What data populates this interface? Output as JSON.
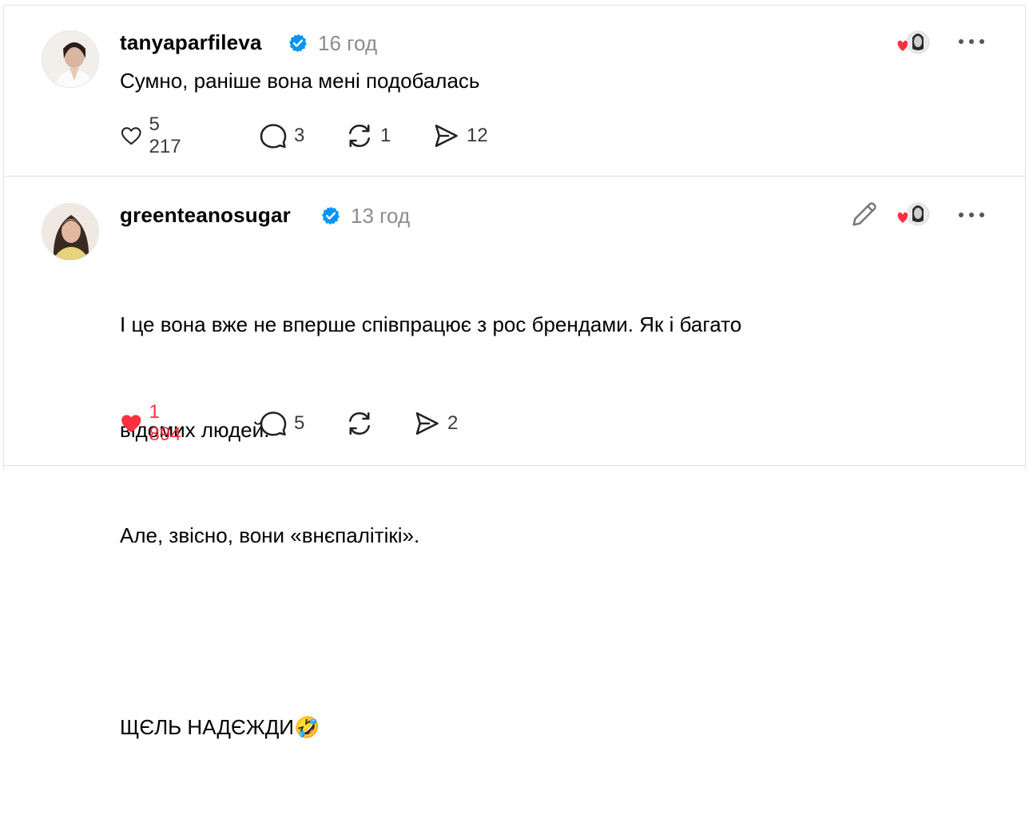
{
  "posts": [
    {
      "username": "tanyaparfileva",
      "time": "16 год",
      "text": "Сумно, раніше вона мені подобалась",
      "likes": "5 217",
      "replies": "3",
      "reposts": "1",
      "shares": "12",
      "liked": false
    },
    {
      "username": "greenteanosugar",
      "time": "13 год",
      "text_lines": [
        "І це вона вже не вперше співпрацює з рос брендами. Як і багато",
        "відомих людей.",
        "Але, звісно, вони «внєпалітікі».",
        "",
        "ЩЄЛЬ НАДЄЖДИ🤣"
      ],
      "likes": "1 894",
      "replies": "5",
      "reposts": "",
      "shares": "2",
      "liked": true
    }
  ],
  "colors": {
    "like_active": "#ff3040",
    "verified": "#0095f6",
    "secondary_text": "#8c8c8c",
    "divider": "#e3e3e3"
  },
  "icons": {
    "verified": "verified-badge-icon",
    "like": "heart-icon",
    "reply": "comment-bubble-icon",
    "repost": "repost-icon",
    "share": "send-icon",
    "more": "more-horizontal-icon",
    "edit": "pencil-icon"
  }
}
